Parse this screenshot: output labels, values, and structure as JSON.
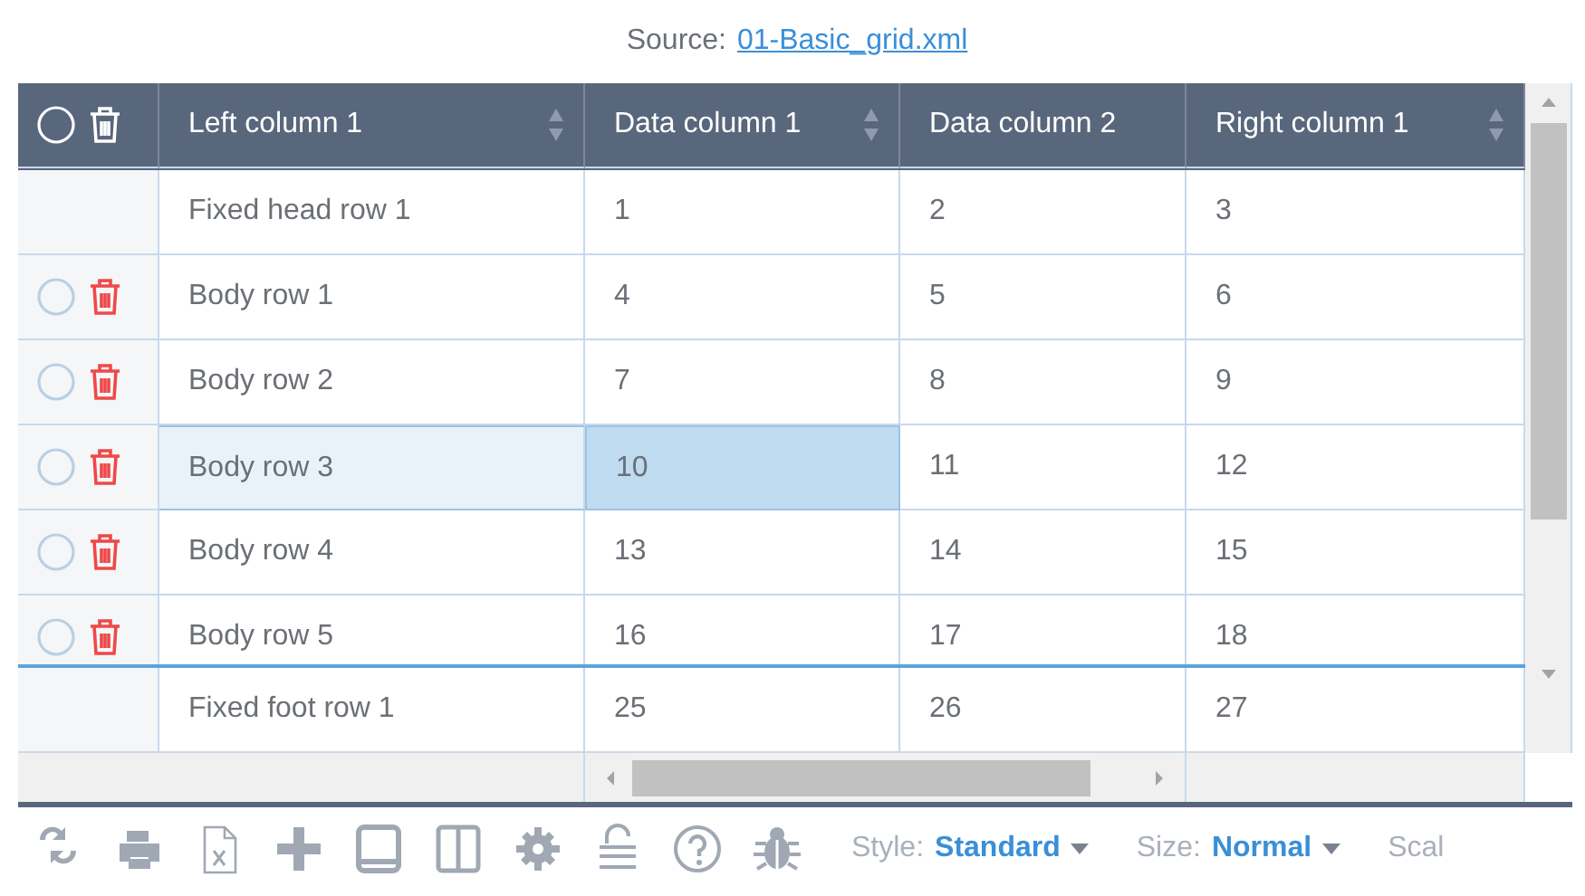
{
  "source": {
    "label": "Source:",
    "link": "01-Basic_grid.xml"
  },
  "select_all_checked": false,
  "columns": [
    {
      "label": "Left column 1",
      "sortable": true
    },
    {
      "label": "Data column 1",
      "sortable": true
    },
    {
      "label": "Data column 2",
      "sortable": false
    },
    {
      "label": "Right column 1",
      "sortable": true
    }
  ],
  "head_rows": [
    {
      "cells": [
        "Fixed head row 1",
        "1",
        "2",
        "3"
      ]
    }
  ],
  "body_rows": [
    {
      "selected": false,
      "checked": false,
      "cells": [
        {
          "text": "Body row 1",
          "focused": false
        },
        {
          "text": "4",
          "focused": false
        },
        {
          "text": "5",
          "focused": false
        },
        {
          "text": "6",
          "focused": false
        }
      ]
    },
    {
      "selected": false,
      "checked": false,
      "cells": [
        {
          "text": "Body row 2",
          "focused": false
        },
        {
          "text": "7",
          "focused": false
        },
        {
          "text": "8",
          "focused": false
        },
        {
          "text": "9",
          "focused": false
        }
      ]
    },
    {
      "selected": true,
      "checked": false,
      "cells": [
        {
          "text": "Body row 3",
          "focused": false
        },
        {
          "text": "10",
          "focused": true
        },
        {
          "text": "11",
          "focused": false
        },
        {
          "text": "12",
          "focused": false
        }
      ]
    },
    {
      "selected": false,
      "checked": false,
      "cells": [
        {
          "text": "Body row 4",
          "focused": false
        },
        {
          "text": "13",
          "focused": false
        },
        {
          "text": "14",
          "focused": false
        },
        {
          "text": "15",
          "focused": false
        }
      ]
    },
    {
      "selected": false,
      "checked": false,
      "cells": [
        {
          "text": "Body row 5",
          "focused": false
        },
        {
          "text": "16",
          "focused": false
        },
        {
          "text": "17",
          "focused": false
        },
        {
          "text": "18",
          "focused": false
        }
      ]
    }
  ],
  "foot_rows": [
    {
      "cells": [
        "Fixed foot row 1",
        "25",
        "26",
        "27"
      ]
    }
  ],
  "toolbar": {
    "dropdowns": [
      {
        "label": "Style:",
        "value": "Standard"
      },
      {
        "label": "Size:",
        "value": "Normal"
      }
    ],
    "trailing_label": "Scal"
  }
}
